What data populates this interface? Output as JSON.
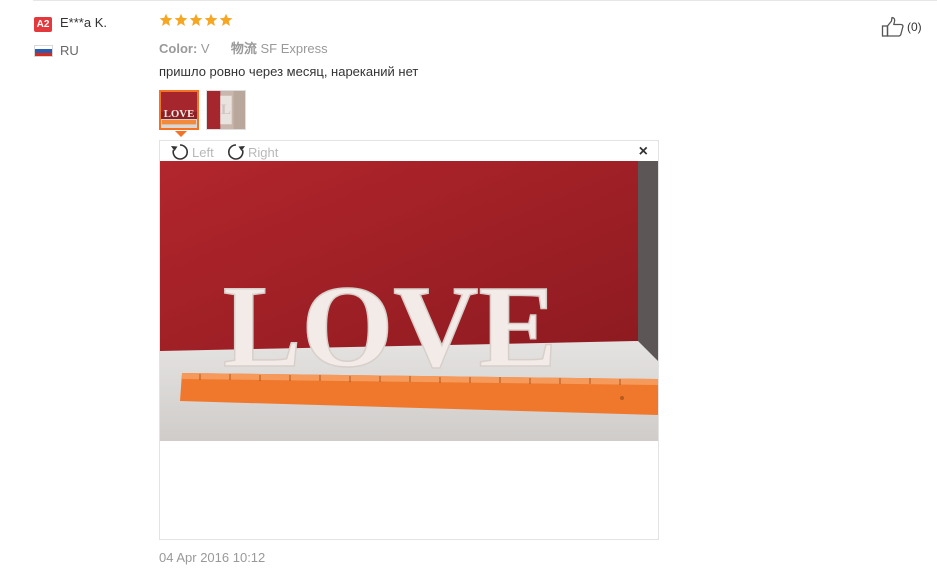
{
  "reviewer": {
    "level_badge": "A2",
    "name": "E***a K.",
    "country": "RU"
  },
  "rating": {
    "stars": 5,
    "max": 5,
    "color": "#f5a623"
  },
  "meta": {
    "color_label": "Color:",
    "color_value": "V",
    "logistics_label": "物流",
    "logistics_value": "SF Express"
  },
  "review_text": "пришло ровно через месяц, нареканий нет",
  "thumbnails": [
    {
      "name": "LOVE letters photo",
      "selected": true
    },
    {
      "name": "Letter L photo",
      "selected": false
    }
  ],
  "viewer": {
    "rotate_left_label": "Left",
    "rotate_right_label": "Right",
    "close_label": "×",
    "photo_text": "LOVE"
  },
  "date": "04 Apr 2016 10:12",
  "helpful": {
    "count_label": "(0)"
  },
  "colors": {
    "accent": "#f57224",
    "badge": "#e4393c"
  }
}
